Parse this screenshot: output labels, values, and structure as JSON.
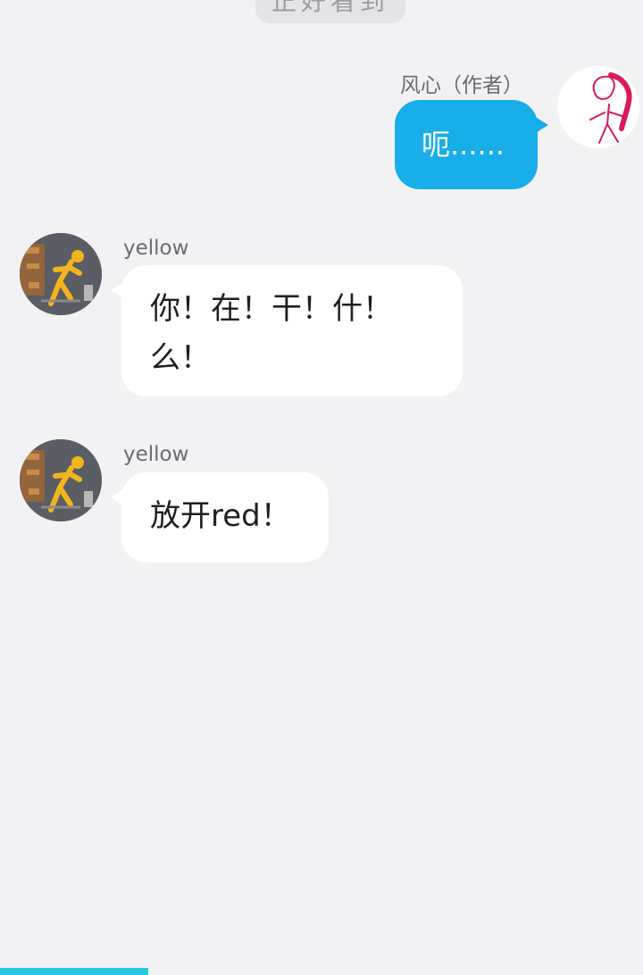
{
  "top_pill": "正好看到",
  "colors": {
    "background": "#f2f2f4",
    "author_bubble": "#17aeea",
    "yellow_stickman": "#f3b51d",
    "red_stickman": "#d91a5a",
    "progress": "#27c9df"
  },
  "messages": [
    {
      "sender": "风心（作者）",
      "text": "呃......",
      "side": "right",
      "avatar_icon": "red-stickman-icon"
    },
    {
      "sender": "yellow",
      "text_lines": [
        "你！在！干！什！",
        "么！"
      ],
      "side": "left",
      "avatar_icon": "yellow-stickman-icon"
    },
    {
      "sender": "yellow",
      "text": "放开red！",
      "side": "left",
      "avatar_icon": "yellow-stickman-icon"
    }
  ],
  "progress": 0.23
}
